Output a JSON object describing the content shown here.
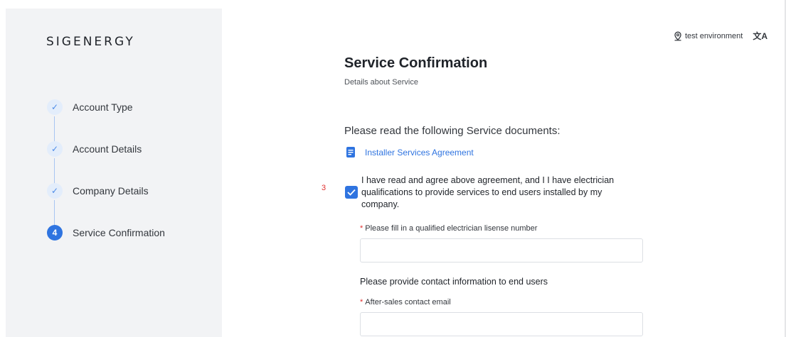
{
  "brand": {
    "logo_text": "SIGENERGY"
  },
  "sidebar": {
    "steps": [
      {
        "label": "Account Type",
        "state": "done",
        "marker": "✓"
      },
      {
        "label": "Account Details",
        "state": "done",
        "marker": "✓"
      },
      {
        "label": "Company Details",
        "state": "done",
        "marker": "✓"
      },
      {
        "label": "Service Confirmation",
        "state": "active",
        "marker": "4"
      }
    ]
  },
  "topbar": {
    "env_label": "test environment",
    "env_icon": "location-pin-icon",
    "lang_icon": "translate-icon",
    "lang_glyph": "文A"
  },
  "main": {
    "title": "Service Confirmation",
    "subtitle": "Details about Service",
    "read_docs": "Please read the following Service documents:",
    "doc_link": {
      "label": "Installer Services Agreement",
      "icon": "document-icon"
    },
    "marker_number": "3",
    "agreement": {
      "checked": true,
      "text": "I have read and agree above agreement, and I I have electrician qualifications to provide services to end users installed by my company."
    },
    "license_field": {
      "required_mark": "*",
      "label": "Please fill in a qualified electrician lisense number",
      "value": "",
      "placeholder": ""
    },
    "contact_section": "Please provide contact information to end users",
    "email_field": {
      "required_mark": "*",
      "label": "After-sales contact email",
      "value": "",
      "placeholder": ""
    }
  },
  "colors": {
    "accent": "#2f74e0",
    "sidebar_bg": "#f2f3f5",
    "required": "#e0302f"
  }
}
